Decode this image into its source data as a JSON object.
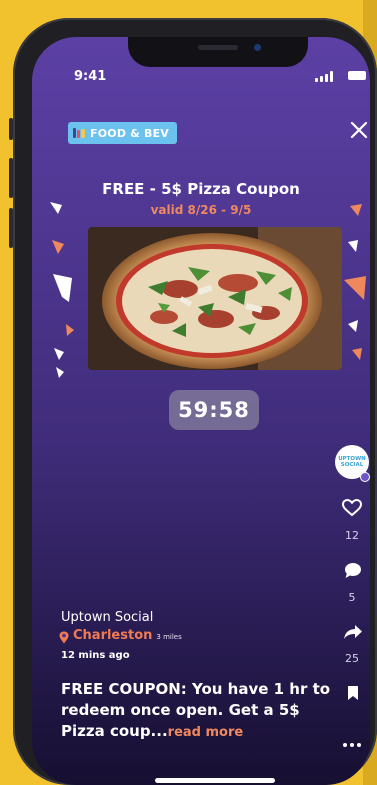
{
  "status_bar": {
    "time": "9:41"
  },
  "category_badge": {
    "label": "FOOD & BEV",
    "color": "#6cc2ee"
  },
  "coupon": {
    "title": "FREE - 5$ Pizza Coupon",
    "valid": "valid 8/26 - 9/5",
    "image_icon": "pizza-photo"
  },
  "timer": {
    "value": "59:58"
  },
  "rail": {
    "avatar_text_line1": "UPTOWN",
    "avatar_text_line2": "SOCIAL",
    "like_count": "12",
    "comment_count": "5",
    "share_count": "25"
  },
  "post": {
    "author": "Uptown Social",
    "location": "Charleston",
    "distance": "3 miles",
    "time_ago": "12 mins ago",
    "description": "FREE COUPON: You have 1 hr to redeem once open. Get a 5$ Pizza coup...",
    "read_more": "read more"
  },
  "colors": {
    "accent": "#f0885e",
    "background": "#f2c12e",
    "screen_top": "#5c40a5",
    "badge": "#6cc2ee"
  }
}
